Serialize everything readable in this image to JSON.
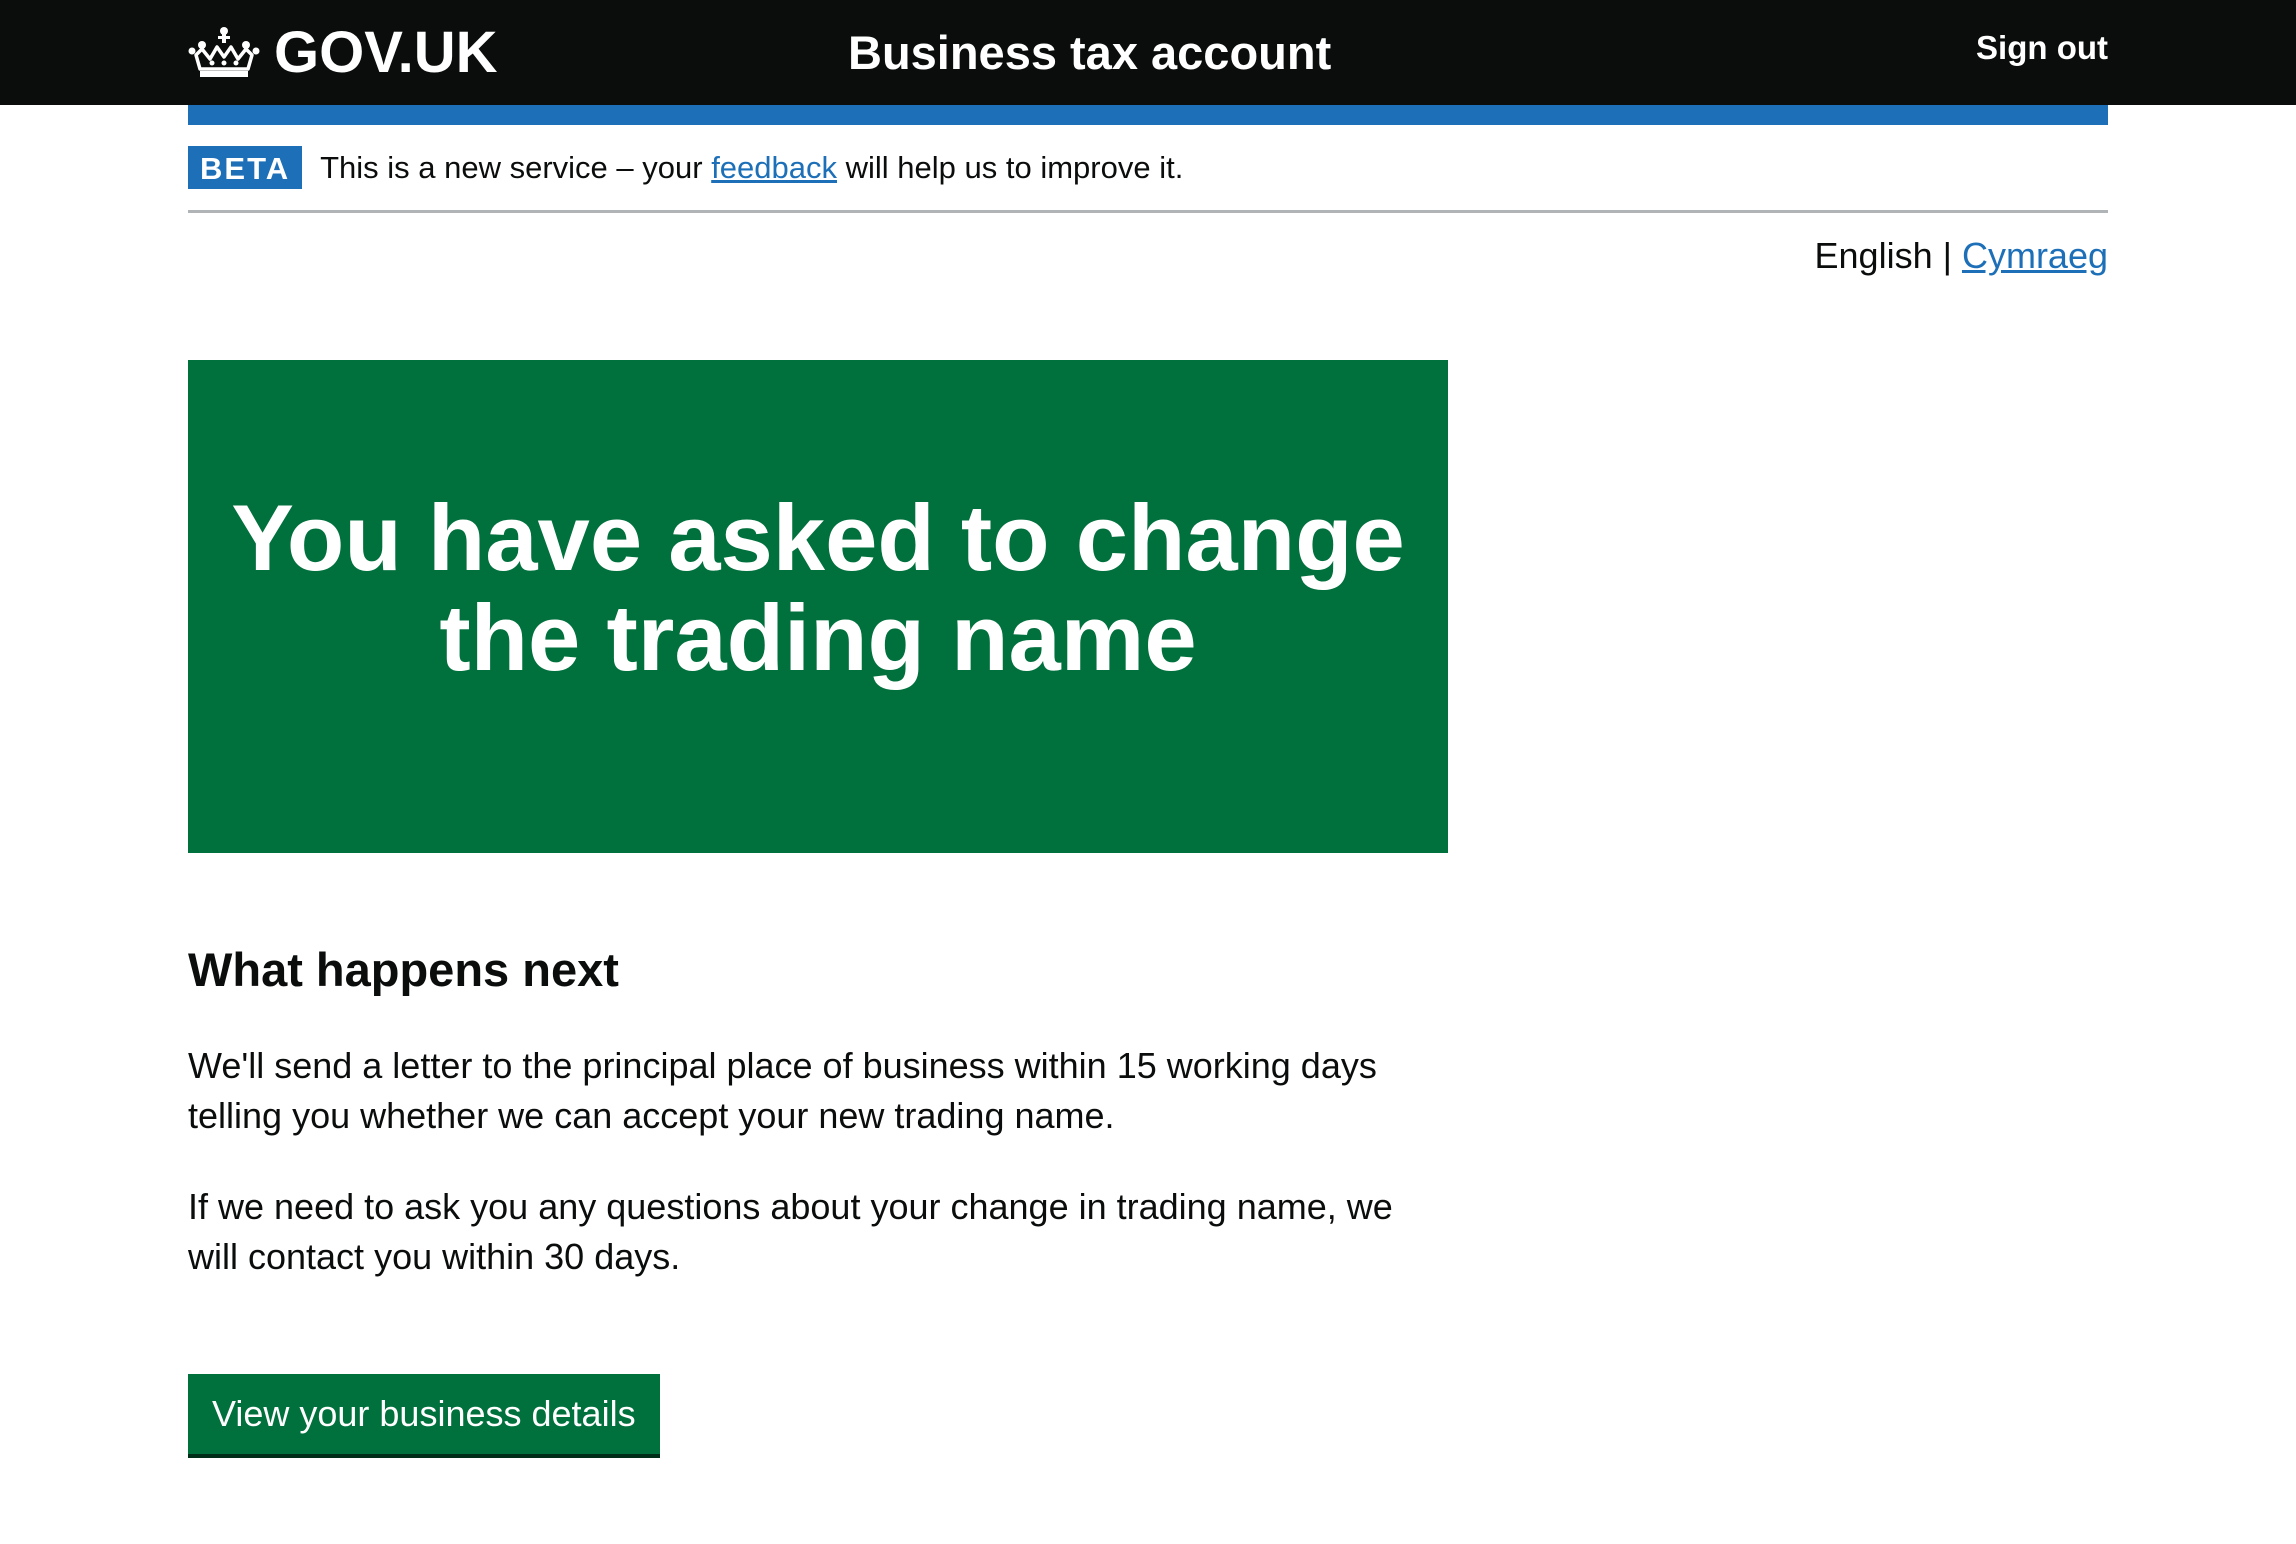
{
  "header": {
    "logo_text": "GOV.UK",
    "service_name": "Business tax account",
    "sign_out_label": "Sign out"
  },
  "phase_banner": {
    "tag": "BETA",
    "text_before": "This is a new service – your ",
    "link_text": "feedback",
    "text_after": " will help us to improve it."
  },
  "language": {
    "current": "English",
    "separator": " | ",
    "alternate": "Cymraeg"
  },
  "panel": {
    "title": "You have asked to change the trading name"
  },
  "content": {
    "heading": "What happens next",
    "paragraphs": [
      "We'll send a letter to the principal place of business within 15 working days telling you whether we can accept your new trading name.",
      "If we need to ask you any questions about your change in trading name, we will contact you within 30 days."
    ],
    "button_label": "View your business details"
  },
  "colors": {
    "header_bg": "#0b0c0c",
    "brand_blue": "#1d70b8",
    "panel_green": "#00703c",
    "button_green": "#00703c",
    "border_grey": "#b1b4b6"
  },
  "icons": {
    "logo_icon": "crown-icon"
  }
}
